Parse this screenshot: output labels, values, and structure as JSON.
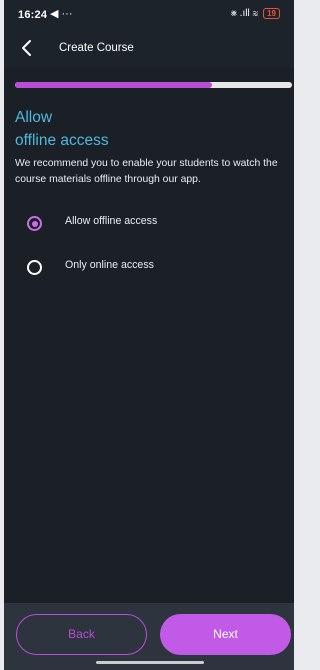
{
  "status_bar": {
    "time": "16:24",
    "left_icons": "◀ ···",
    "right_icons": "⨳ .ıll ≋",
    "battery": "19"
  },
  "header": {
    "title": "Create Course"
  },
  "progress": {
    "fraction": 0.71
  },
  "main": {
    "heading_line1": "Allow",
    "heading_line2": "offline access",
    "description": "We recommend you to enable your students to watch the course materials offline through our app.",
    "options": [
      {
        "label": "Allow offline access",
        "selected": true
      },
      {
        "label": "Only online access",
        "selected": false
      }
    ]
  },
  "footer": {
    "back_label": "Back",
    "next_label": "Next"
  },
  "colors": {
    "accent": "#c15ae6",
    "heading": "#4fb8de",
    "background": "#1b2027"
  }
}
